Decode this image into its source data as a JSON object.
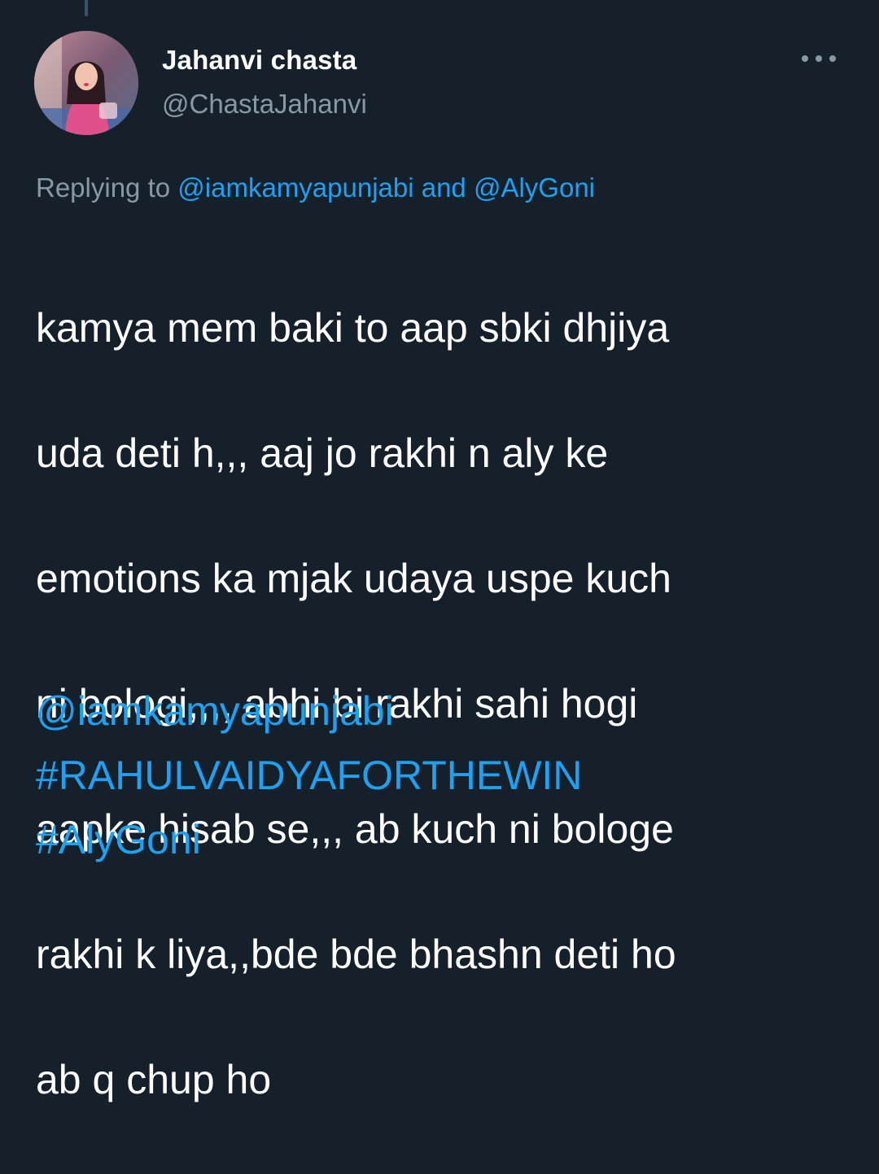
{
  "tweet": {
    "author": {
      "display_name": "Jahanvi chasta",
      "handle": "@ChastaJahanvi"
    },
    "replying_to": {
      "prefix": "Replying to ",
      "mention_1": "@iamkamyapunjabi",
      "conjunction": " and ",
      "mention_2": "@AlyGoni"
    },
    "body_lines": [
      "kamya mem baki to aap sbki dhjiya",
      "uda deti h,,, aaj jo rakhi n aly ke",
      "emotions ka mjak udaya uspe kuch",
      "ni bologi,,,, abhi bi rakhi sahi hogi",
      "aapke hisab se,,, ab kuch ni bologe",
      "rakhi k liya,,bde bde bhashn deti ho",
      "ab q chup ho"
    ],
    "links": {
      "mention": "@iamkamyapunjabi",
      "hashtag_1": "#RAHULVAIDYAFORTHEWIN",
      "hashtag_2": "#AlyGoni"
    }
  },
  "icons": {
    "more": "more-horizontal-icon",
    "avatar": "profile-photo"
  },
  "colors": {
    "background": "#15202b",
    "text": "#ffffff",
    "secondary_text": "#8899a6",
    "link": "#1da1f2"
  }
}
